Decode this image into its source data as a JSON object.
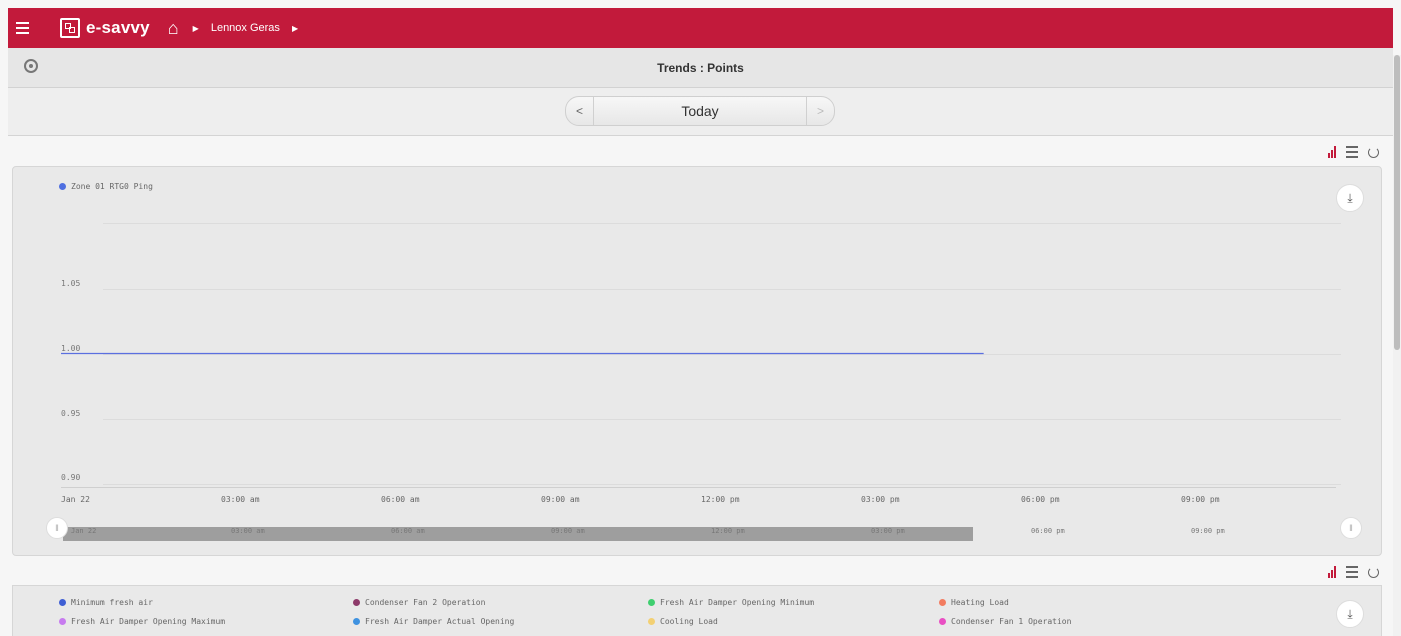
{
  "header": {
    "brand": "e-savvy",
    "breadcrumb": [
      "Lennox Geras"
    ],
    "colors": {
      "brand": "#c21a3b"
    },
    "icons": [
      "menu-icon",
      "logo-icon",
      "home-icon",
      "chevron-right-icon"
    ]
  },
  "page": {
    "title": "Trends : Points"
  },
  "date_nav": {
    "prev": "<",
    "label": "Today",
    "next": ">"
  },
  "chart": {
    "legend": [
      {
        "name": "Zone 01 RTG0 Ping",
        "color": "#4f6fe0"
      }
    ],
    "y_ticks": [
      "1.05",
      "1.00",
      "0.95",
      "0.90"
    ],
    "x_ticks": [
      "Jan 22",
      "03:00 am",
      "06:00 am",
      "09:00 am",
      "12:00 pm",
      "03:00 pm",
      "06:00 pm",
      "09:00 pm"
    ],
    "navigator_ticks": [
      "Jan 22",
      "03:00 am",
      "06:00 am",
      "09:00 am",
      "12:00 pm",
      "03:00 pm",
      "06:00 pm",
      "09:00 pm"
    ]
  },
  "chart_data": {
    "type": "line",
    "title": "",
    "xlabel": "",
    "ylabel": "",
    "x_range_hours": [
      0,
      24
    ],
    "ylim": [
      0.9,
      1.1
    ],
    "series": [
      {
        "name": "Zone 01 RTG0 Ping",
        "color": "#5b6fe0",
        "points": [
          [
            0,
            1.0
          ],
          [
            17.3,
            1.0
          ]
        ]
      }
    ],
    "grid": true
  },
  "bottom_legend": {
    "items": [
      {
        "name": "Minimum fresh air",
        "color": "#3f5fd4"
      },
      {
        "name": "Condenser Fan 2 Operation",
        "color": "#8d3a6a"
      },
      {
        "name": "Fresh Air Damper Opening Minimum",
        "color": "#3fcf6f"
      },
      {
        "name": "Heating Load",
        "color": "#f27c60"
      },
      {
        "name": "Fresh Air Damper Opening Maximum",
        "color": "#c77bef"
      },
      {
        "name": "Fresh Air Damper Actual Opening",
        "color": "#3f92e0"
      },
      {
        "name": "Cooling Load",
        "color": "#f3d073"
      },
      {
        "name": "Condenser Fan 1 Operation",
        "color": "#e94fc3"
      }
    ]
  }
}
